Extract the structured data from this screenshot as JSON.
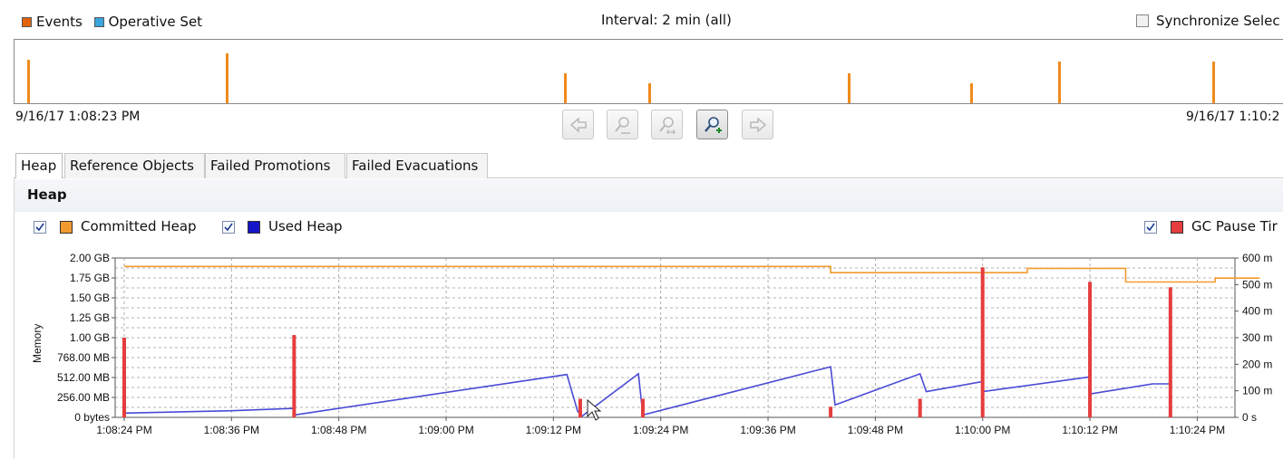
{
  "overview": {
    "legend": [
      {
        "label": "Events",
        "color": "#e0640a"
      },
      {
        "label": "Operative Set",
        "color": "#39a6dc"
      }
    ],
    "interval_label": "Interval: 2 min (all)",
    "sync_label": "Synchronize Selec",
    "start_time": "9/16/17 1:08:23 PM",
    "end_time": "9/16/17 1:10:2",
    "event_color": "#f08a1c"
  },
  "toolbar": {
    "buttons": [
      "back",
      "zoom-out",
      "zoom-reset",
      "zoom-in",
      "forward"
    ]
  },
  "tabs": [
    "Heap",
    "Reference Objects",
    "Failed Promotions",
    "Failed Evacuations"
  ],
  "panel": {
    "title": "Heap",
    "legend": [
      {
        "label": "Committed Heap",
        "color": "#f29a2e",
        "checked": true
      },
      {
        "label": "Used Heap",
        "color": "#1515c8",
        "checked": true
      },
      {
        "label": "GC Pause Tir",
        "color": "#e53d3d",
        "checked": true
      }
    ]
  },
  "chart_data": {
    "type": "line",
    "ylabel": "Memory",
    "y_ticks": [
      "0 bytes",
      "256.00 MB",
      "512.00 MB",
      "768.00 MB",
      "1.00 GB",
      "1.25 GB",
      "1.50 GB",
      "1.75 GB",
      "2.00 GB"
    ],
    "y_ticks_mb": [
      0,
      256,
      512,
      768,
      1024,
      1280,
      1536,
      1792,
      2048
    ],
    "ylim_mb": [
      0,
      2048
    ],
    "y2_ticks": [
      "0 s",
      "100 m",
      "200 m",
      "300 m",
      "400 m",
      "500 m",
      "600 m"
    ],
    "y2lim_ms": [
      0,
      600
    ],
    "x_ticks": [
      "1:08:24 PM",
      "1:08:36 PM",
      "1:08:48 PM",
      "1:09:00 PM",
      "1:09:12 PM",
      "1:09:24 PM",
      "1:09:36 PM",
      "1:09:48 PM",
      "1:10:00 PM",
      "1:10:12 PM",
      "1:10:24 PM"
    ],
    "x_tick_seconds": [
      0,
      12,
      24,
      36,
      48,
      60,
      72,
      84,
      96,
      108,
      120
    ],
    "xlim_seconds": [
      0,
      120
    ],
    "series": [
      {
        "name": "Committed Heap",
        "color": "#f29a2e",
        "points": [
          [
            0,
            1940
          ],
          [
            79,
            1940
          ],
          [
            79,
            1860
          ],
          [
            101,
            1860
          ],
          [
            101,
            1915
          ],
          [
            112,
            1915
          ],
          [
            112,
            1740
          ],
          [
            122,
            1740
          ],
          [
            122,
            1790
          ],
          [
            127,
            1790
          ]
        ]
      },
      {
        "name": "Used Heap",
        "color": "#4a4ad6",
        "points": [
          [
            0,
            55
          ],
          [
            12,
            85
          ],
          [
            19,
            115
          ],
          [
            19,
            30
          ],
          [
            49.5,
            550
          ],
          [
            50.7,
            80
          ],
          [
            51.2,
            15
          ],
          [
            57.5,
            560
          ],
          [
            58,
            30
          ],
          [
            58,
            30
          ],
          [
            79,
            650
          ],
          [
            79.5,
            160
          ],
          [
            89,
            560
          ],
          [
            89.7,
            330
          ],
          [
            96,
            460
          ],
          [
            96,
            330
          ],
          [
            108,
            520
          ],
          [
            108,
            300
          ],
          [
            115,
            430
          ],
          [
            117,
            430
          ]
        ]
      },
      {
        "name": "GC Pause Tir",
        "color": "#e53d3d",
        "bars": [
          [
            0,
            300
          ],
          [
            19,
            310
          ],
          [
            51,
            70
          ],
          [
            58,
            70
          ],
          [
            79,
            40
          ],
          [
            89,
            70
          ],
          [
            96,
            565
          ],
          [
            108,
            510
          ],
          [
            117,
            490
          ]
        ]
      }
    ]
  }
}
